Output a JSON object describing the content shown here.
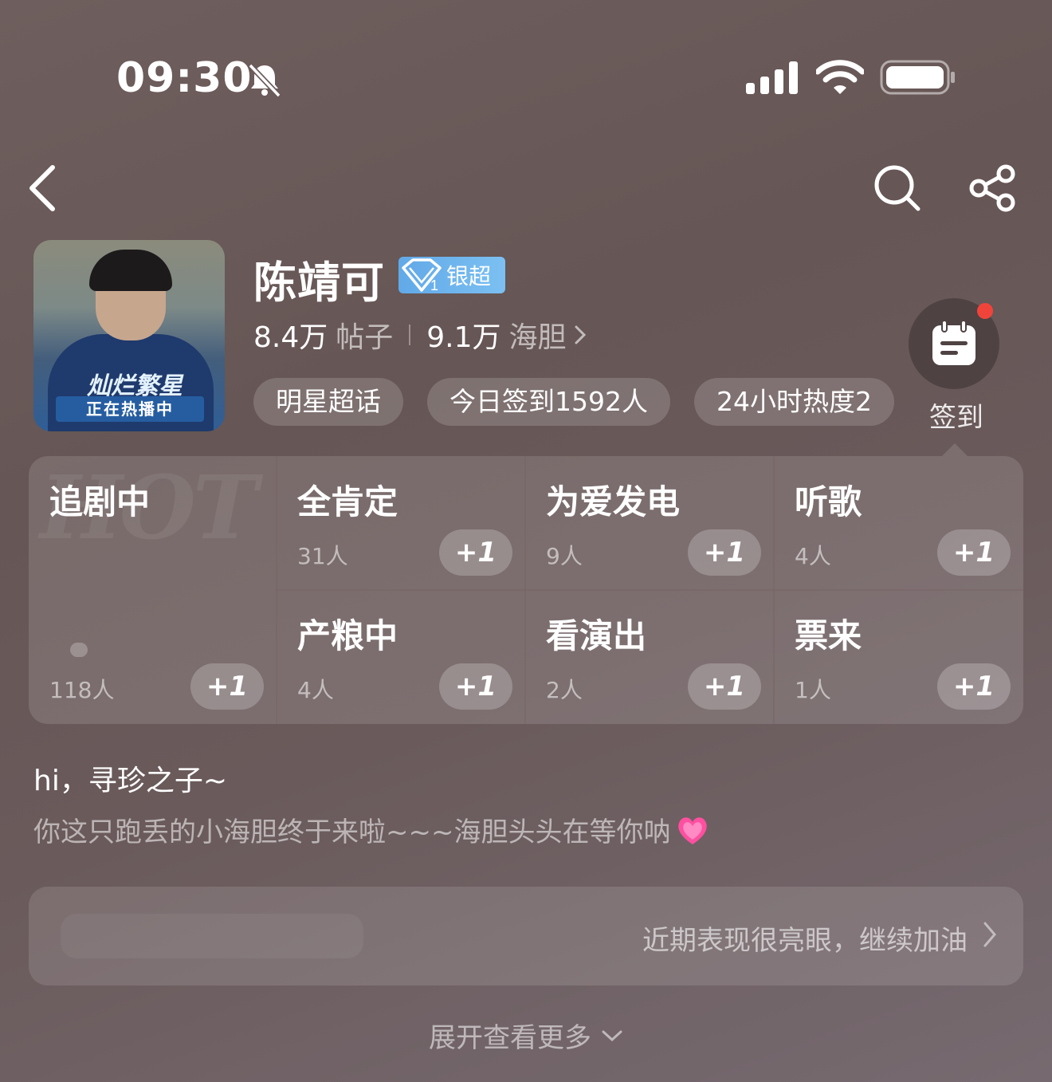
{
  "status_bar": {
    "time": "09:30",
    "icons": [
      "bell-muted-icon",
      "cellular-signal-icon",
      "wifi-icon",
      "battery-icon"
    ]
  },
  "nav": {
    "icons": [
      "back-arrow-icon",
      "search-icon",
      "share-icon"
    ]
  },
  "topic": {
    "cover": {
      "show_title": "灿烂繁星",
      "banner": "正在热播中"
    },
    "name": "陈靖可",
    "badge": {
      "level": "1",
      "label": "银超"
    },
    "posts_count": "8.4万",
    "posts_label": "帖子",
    "fans_count": "9.1万",
    "fans_label": "海胆",
    "tags": [
      "明星超话",
      "今日签到1592人",
      "24小时热度2"
    ]
  },
  "signin": {
    "label": "签到",
    "has_notification": true,
    "icon": "calendar-icon"
  },
  "activities": {
    "watermark": "HOT",
    "main": {
      "title": "追剧中",
      "count": "118人",
      "action": "+1"
    },
    "cells": [
      {
        "title": "全肯定",
        "count": "31人",
        "action": "+1"
      },
      {
        "title": "为爱发电",
        "count": "9人",
        "action": "+1"
      },
      {
        "title": "听歌",
        "count": "4人",
        "action": "+1"
      },
      {
        "title": "产粮中",
        "count": "4人",
        "action": "+1"
      },
      {
        "title": "看演出",
        "count": "2人",
        "action": "+1"
      },
      {
        "title": "票来",
        "count": "1人",
        "action": "+1"
      }
    ]
  },
  "greeting": {
    "line1": "hi，寻珍之子~",
    "line2": "你这只跑丢的小海胆终于来啦~~~海胆头头在等你呐",
    "emoji": "heart-icon"
  },
  "performance": {
    "text": "近期表现很亮眼，继续加油"
  },
  "expand": {
    "label": "展开查看更多"
  },
  "colors": {
    "background": "#6a5a5a",
    "badge": "#6fb4ec",
    "notification_dot": "#f0443a",
    "heart": "#ff4fa0"
  }
}
